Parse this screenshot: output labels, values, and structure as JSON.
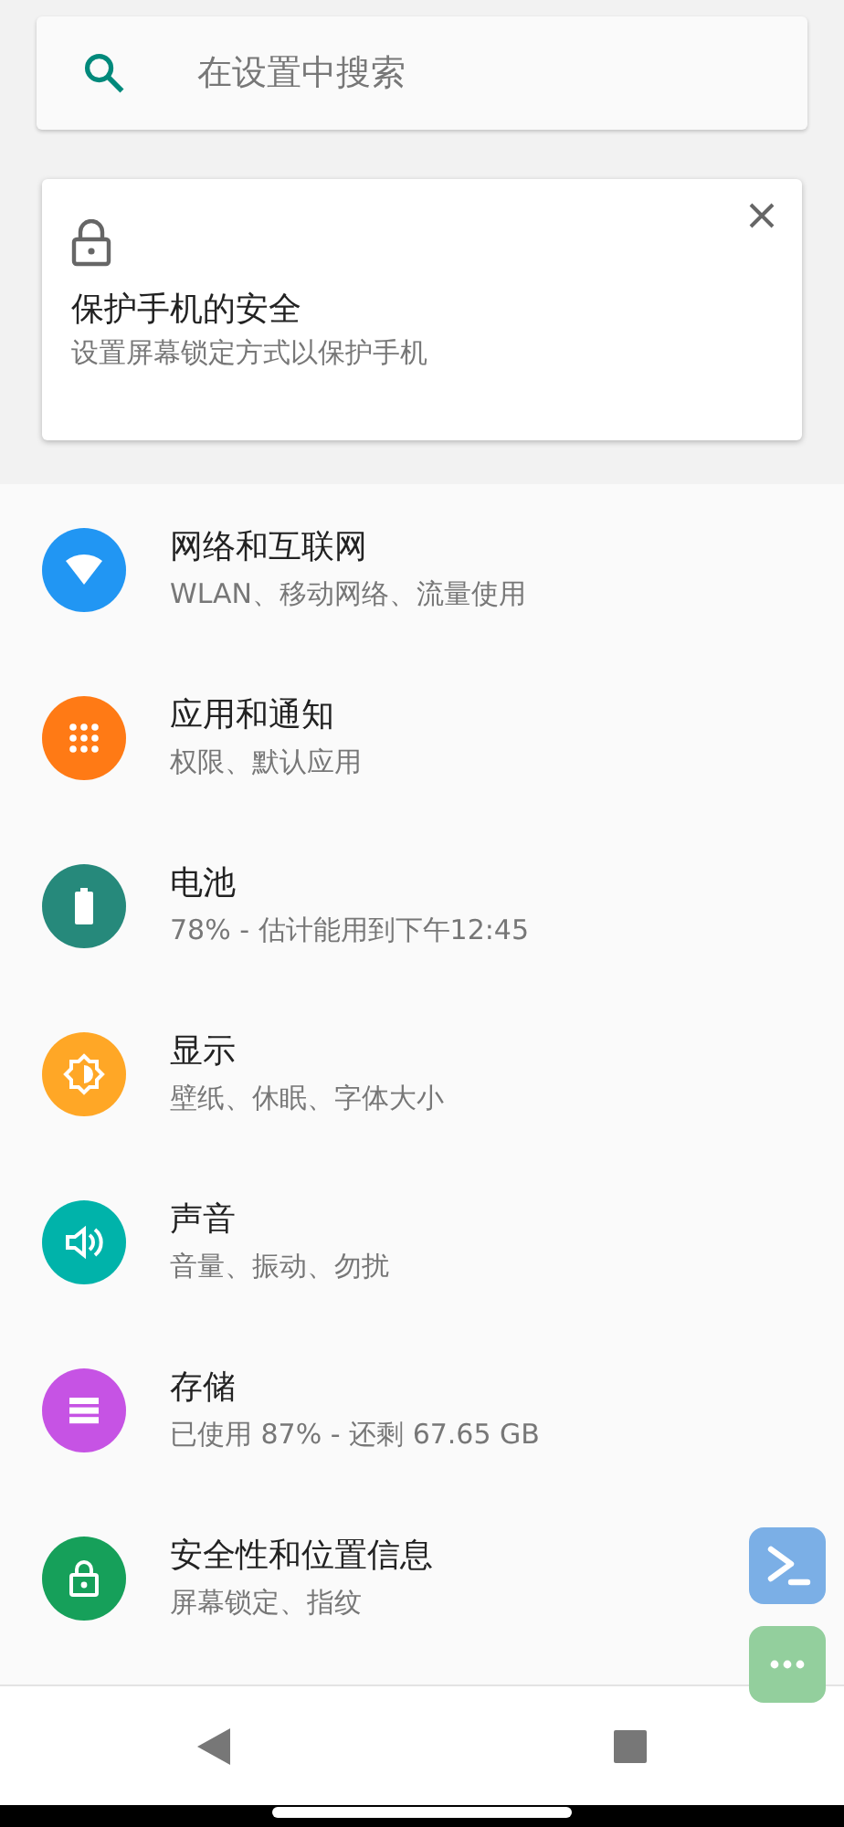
{
  "search": {
    "placeholder": "在设置中搜索"
  },
  "suggestion": {
    "title": "保护手机的安全",
    "summary": "设置屏幕锁定方式以保护手机"
  },
  "categories": [
    {
      "kind": "network",
      "title": "网络和互联网",
      "summary": "WLAN、移动网络、流量使用",
      "color": "#2196f3"
    },
    {
      "kind": "apps",
      "title": "应用和通知",
      "summary": "权限、默认应用",
      "color": "#ff7a15"
    },
    {
      "kind": "battery",
      "title": "电池",
      "summary": "78% - 估计能用到下午12:45",
      "color": "#26897b"
    },
    {
      "kind": "display",
      "title": "显示",
      "summary": "壁纸、休眠、字体大小",
      "color": "#ffa726"
    },
    {
      "kind": "sound",
      "title": "声音",
      "summary": "音量、振动、勿扰",
      "color": "#00b3aa"
    },
    {
      "kind": "storage",
      "title": "存储",
      "summary": "已使用 87% - 还剩 67.65 GB",
      "color": "#c653e4"
    },
    {
      "kind": "security",
      "title": "安全性和位置信息",
      "summary": "屏幕锁定、指纹",
      "color": "#16a05a"
    }
  ]
}
